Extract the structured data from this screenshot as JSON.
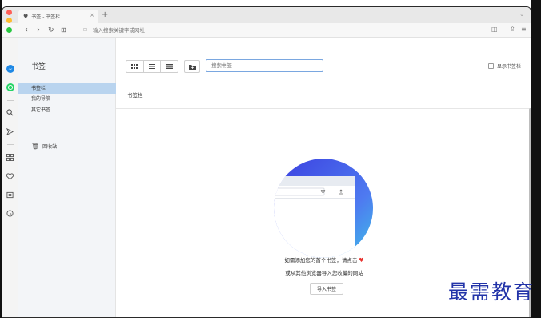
{
  "browser": {
    "tab_title": "书签 - 书签栏",
    "new_tab": "+",
    "address_placeholder": "输入搜索关键字或网址"
  },
  "sidebar": {
    "heading": "书签",
    "items": [
      {
        "label": "书签栏",
        "active": true
      },
      {
        "label": "我的导航",
        "active": false
      },
      {
        "label": "其它书签",
        "active": false
      }
    ],
    "trash_label": "回收站"
  },
  "toolbar": {
    "search_placeholder": "搜索书签",
    "show_bookmark_bar_label": "显示书签栏",
    "show_bookmark_bar_checked": false
  },
  "main": {
    "section_title": "书签栏",
    "empty_line1": "如需添加您的首个书签，请点击",
    "empty_line2": "或从其他浏览器导入您收藏的网站",
    "import_button": "导入书签"
  },
  "watermark": "最需教育",
  "colors": {
    "accent_blue": "#2f6df0",
    "selected_item": "#b9d4ef",
    "heart_red": "#e8322e",
    "traffic_red": "#ff5f57",
    "traffic_yellow": "#febc2e",
    "traffic_green": "#28c840",
    "messenger_blue": "#1e88e5",
    "whatsapp_green": "#25d366"
  }
}
